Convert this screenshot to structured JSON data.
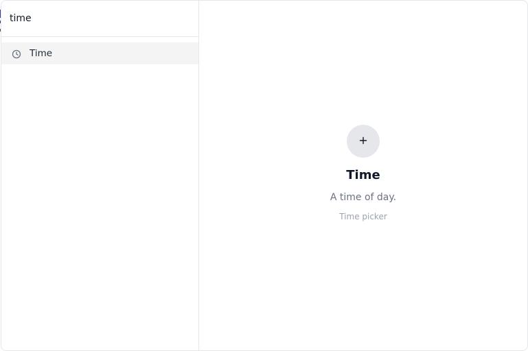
{
  "search": {
    "value": "time",
    "placeholder": ""
  },
  "results": [
    {
      "icon": "clock-icon",
      "label": "Time"
    }
  ],
  "detail": {
    "icon": "plus-icon",
    "title": "Time",
    "description": "A time of day.",
    "subtitle": "Time picker"
  },
  "colors": {
    "border": "#e5e7eb",
    "selected_bg": "#f4f4f5",
    "icon_circle_bg": "#e5e7eb",
    "title": "#111827",
    "muted": "#6b7280",
    "faint": "#9ca3af"
  }
}
